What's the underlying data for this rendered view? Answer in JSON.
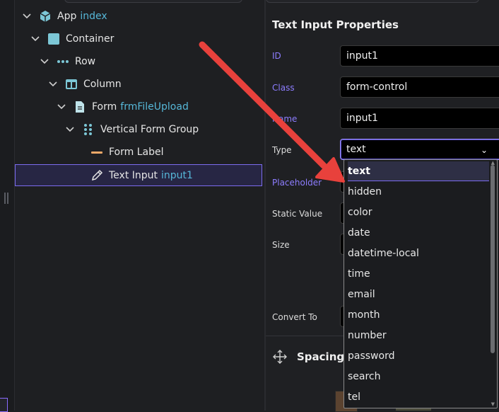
{
  "tree": {
    "nodes": [
      {
        "label": "App",
        "ref": "index"
      },
      {
        "label": "Container",
        "ref": ""
      },
      {
        "label": "Row",
        "ref": ""
      },
      {
        "label": "Column",
        "ref": ""
      },
      {
        "label": "Form",
        "ref": "frmFileUpload"
      },
      {
        "label": "Vertical Form Group",
        "ref": ""
      },
      {
        "label": "Form Label",
        "ref": ""
      },
      {
        "label": "Text Input",
        "ref": "input1"
      }
    ]
  },
  "properties": {
    "title": "Text Input Properties",
    "id_label": "ID",
    "id_value": "input1",
    "class_label": "Class",
    "class_value": "form-control",
    "name_label": "Name",
    "name_value": "input1",
    "type_label": "Type",
    "type_value": "text",
    "placeholder_label": "Placeholder",
    "static_value_label": "Static Value",
    "size_label": "Size",
    "convert_to_label": "Convert To",
    "spacing_label": "Spacing"
  },
  "dropdown": {
    "options": [
      "text",
      "hidden",
      "color",
      "date",
      "datetime-local",
      "time",
      "email",
      "month",
      "number",
      "password",
      "search",
      "tel"
    ],
    "selected": "text"
  },
  "colors": {
    "accent": "#7c6cf0",
    "link": "#56b7d8",
    "arrow": "#e8413c"
  },
  "icons": {
    "app": "cube-icon",
    "container": "square-icon",
    "row": "dots-icon",
    "column": "columns-icon",
    "form": "document-icon",
    "form_group": "grid-dots-icon",
    "form_label": "dash-icon",
    "text_input": "pencil-icon",
    "spacing": "move-icon"
  }
}
